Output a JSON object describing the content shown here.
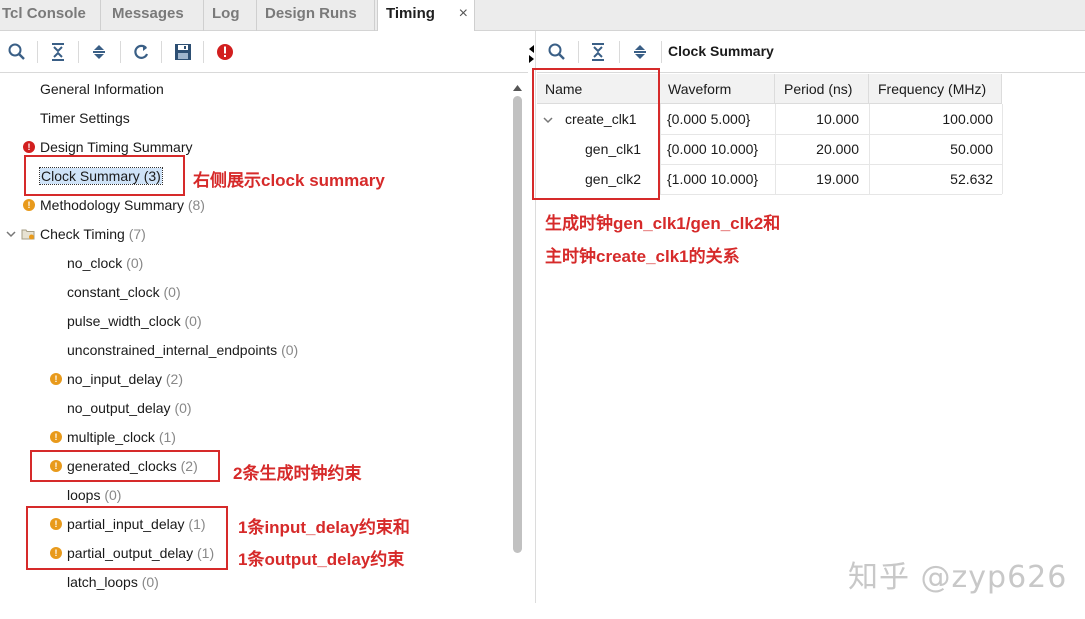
{
  "tabs": [
    {
      "label": "Tcl Console"
    },
    {
      "label": "Messages"
    },
    {
      "label": "Log"
    },
    {
      "label": "Design Runs"
    },
    {
      "label": "Timing",
      "close": "×"
    }
  ],
  "right_panel": {
    "title": "Clock Summary"
  },
  "tree": [
    {
      "label": "General Information",
      "count": ""
    },
    {
      "label": "Timer Settings",
      "count": ""
    },
    {
      "label": "Design Timing Summary",
      "count": ""
    },
    {
      "label": "Clock Summary",
      "count": "(3)"
    },
    {
      "label": "Methodology Summary",
      "count": "(8)"
    },
    {
      "label": "Check Timing",
      "count": "(7)"
    },
    {
      "label": "no_clock",
      "count": "(0)"
    },
    {
      "label": "constant_clock",
      "count": "(0)"
    },
    {
      "label": "pulse_width_clock",
      "count": "(0)"
    },
    {
      "label": "unconstrained_internal_endpoints",
      "count": "(0)"
    },
    {
      "label": "no_input_delay",
      "count": "(2)"
    },
    {
      "label": "no_output_delay",
      "count": "(0)"
    },
    {
      "label": "multiple_clock",
      "count": "(1)"
    },
    {
      "label": "generated_clocks",
      "count": "(2)"
    },
    {
      "label": "loops",
      "count": "(0)"
    },
    {
      "label": "partial_input_delay",
      "count": "(1)"
    },
    {
      "label": "partial_output_delay",
      "count": "(1)"
    },
    {
      "label": "latch_loops",
      "count": "(0)"
    }
  ],
  "table": {
    "headers": [
      "Name",
      "Waveform",
      "Period (ns)",
      "Frequency (MHz)"
    ],
    "rows": [
      {
        "name": "create_clk1",
        "waveform": "{0.000 5.000}",
        "period": "10.000",
        "frequency": "100.000"
      },
      {
        "name": "gen_clk1",
        "waveform": "{0.000 10.000}",
        "period": "20.000",
        "frequency": "50.000"
      },
      {
        "name": "gen_clk2",
        "waveform": "{1.000 10.000}",
        "period": "19.000",
        "frequency": "52.632"
      }
    ]
  },
  "annotations": {
    "clock_summary": "右侧展示clock summary",
    "generated": "2条生成时钟约束",
    "input_delay": "1条input_delay约束和",
    "output_delay": "1条output_delay约束",
    "relation_line1": "生成时钟gen_clk1/gen_clk2和",
    "relation_line2": "主时钟create_clk1的关系"
  },
  "watermark": "知乎 @zyp626",
  "colors": {
    "annotation_red": "#d62a2a",
    "warning": "#e89a1c",
    "error": "#d21f1f",
    "selection": "#cfe3f8"
  }
}
